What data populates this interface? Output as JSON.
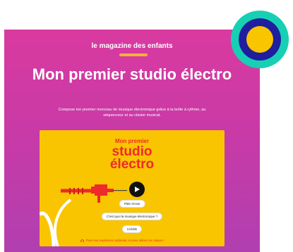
{
  "header": {
    "brand": "le magazine des enfants"
  },
  "main": {
    "title": "Mon premier studio électro",
    "subtitle": "Compose ton premier morceau de musique électronique grâce à la boîte à rythme, au séquenceur et au clavier musical."
  },
  "card": {
    "kicker": "Mon premier",
    "title_line1": "studio",
    "title_line2": "électro",
    "buttons": {
      "fullscreen": "Plein écran",
      "what_is": "C'est quoi la musique électronique ?",
      "credits": "Crédits"
    },
    "notice": "Pour une expérience optimale, tu peux utiliser un casque !"
  },
  "colors": {
    "page_top": "#d93aa0",
    "page_bottom": "#b13fb0",
    "card_bg": "#f9c400",
    "accent_red": "#ee2a2a",
    "badge_teal": "#17d0b4",
    "badge_blue": "#1e1e9e"
  },
  "icons": {
    "play": "play-icon",
    "headphones": "headphones-icon",
    "badge": "brand-badge-icon"
  }
}
